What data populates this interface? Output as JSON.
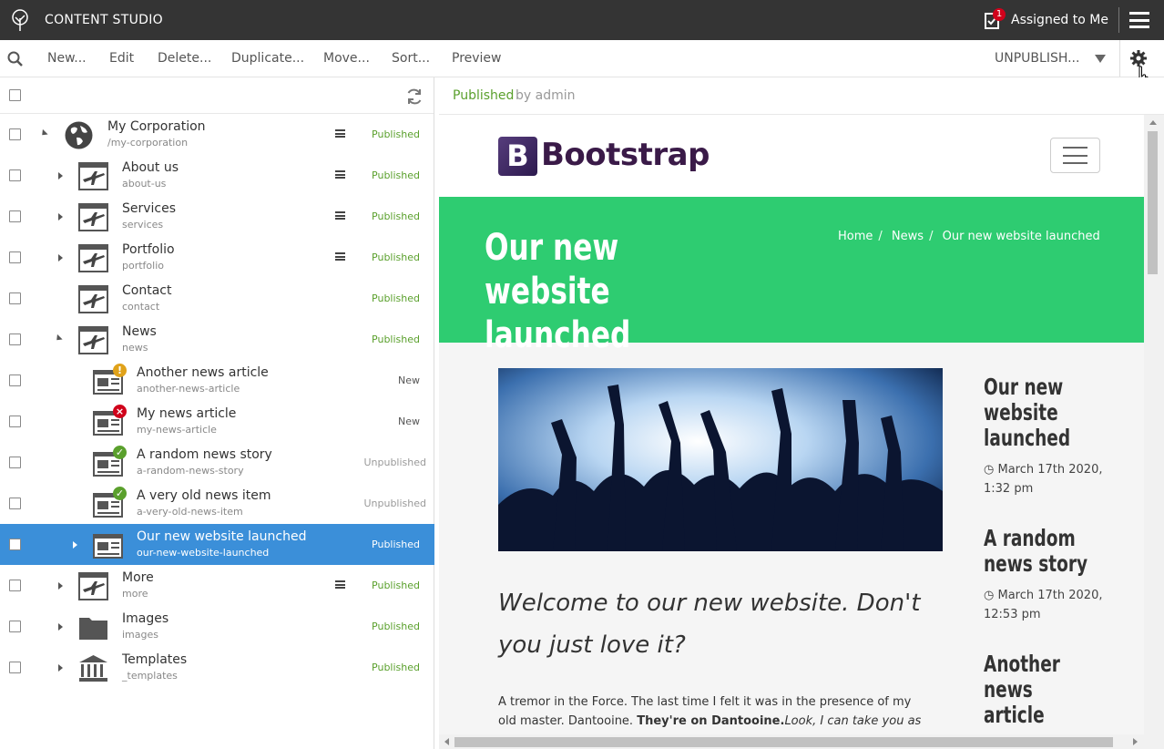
{
  "app": {
    "title": "CONTENT STUDIO"
  },
  "header": {
    "assigned_label": "Assigned to Me",
    "assigned_count": "1"
  },
  "toolbar": {
    "items": [
      "New...",
      "Edit",
      "Delete...",
      "Duplicate...",
      "Move...",
      "Sort...",
      "Preview"
    ],
    "unpublish_label": "UNPUBLISH..."
  },
  "tree": {
    "rows": [
      {
        "name": "My Corporation",
        "path": "/my-corporation",
        "status": "Published",
        "icon": "globe-icon",
        "has_menu": true,
        "toggle": "down",
        "level": 0
      },
      {
        "name": "About us",
        "path": "about-us",
        "status": "Published",
        "icon": "page-template-icon",
        "has_menu": true,
        "toggle": "right",
        "level": 1
      },
      {
        "name": "Services",
        "path": "services",
        "status": "Published",
        "icon": "page-template-icon",
        "has_menu": true,
        "toggle": "right",
        "level": 1
      },
      {
        "name": "Portfolio",
        "path": "portfolio",
        "status": "Published",
        "icon": "page-template-icon",
        "has_menu": true,
        "toggle": "right",
        "level": 1
      },
      {
        "name": "Contact",
        "path": "contact",
        "status": "Published",
        "icon": "page-template-icon",
        "has_menu": false,
        "toggle": "none",
        "level": 1
      },
      {
        "name": "News",
        "path": "news",
        "status": "Published",
        "icon": "page-template-icon",
        "has_menu": false,
        "toggle": "down",
        "level": 1
      },
      {
        "name": "Another news article",
        "path": "another-news-article",
        "status": "New",
        "icon": "article-icon",
        "badge": "warning",
        "level": 2
      },
      {
        "name": "My news article",
        "path": "my-news-article",
        "status": "New",
        "icon": "article-icon",
        "badge": "error",
        "level": 2
      },
      {
        "name": "A random news story",
        "path": "a-random-news-story",
        "status": "Unpublished",
        "icon": "article-icon",
        "badge": "ok",
        "level": 2
      },
      {
        "name": "A very old news item",
        "path": "a-very-old-news-item",
        "status": "Unpublished",
        "icon": "article-icon",
        "badge": "ok",
        "level": 2
      },
      {
        "name": "Our new website launched",
        "path": "our-new-website-launched",
        "status": "Published",
        "icon": "article-icon",
        "toggle": "right",
        "selected": true,
        "level": 2
      },
      {
        "name": "More",
        "path": "more",
        "status": "Published",
        "icon": "page-template-icon",
        "has_menu": true,
        "toggle": "right",
        "level": 1
      },
      {
        "name": "Images",
        "path": "images",
        "status": "Published",
        "icon": "folder-icon",
        "toggle": "right",
        "level": 1
      },
      {
        "name": "Templates",
        "path": "_templates",
        "status": "Published",
        "icon": "templates-icon",
        "toggle": "right",
        "level": 1
      }
    ]
  },
  "preview": {
    "status": "Published",
    "by": "by admin",
    "site": {
      "logo_letter": "B",
      "logo_text": "Bootstrap",
      "hero_title": "Our new website launched",
      "breadcrumb": [
        "Home",
        "News",
        "Our new website launched"
      ],
      "lead": "Welcome to our new website. Don't you just love it?",
      "body_plain": "A tremor in the Force. The last time I felt it was in the presence of my old master. Dantooine. ",
      "body_bold": "They're on Dantooine.",
      "body_italic": "Look, I can take you as far as",
      "sidebar": [
        {
          "title": "Our new website launched",
          "date": "March 17th 2020, 1:32 pm"
        },
        {
          "title": "A random news story",
          "date": "March 17th 2020, 12:53 pm"
        },
        {
          "title": "Another news article",
          "date": ""
        }
      ]
    }
  },
  "colors": {
    "topbar": "#343434",
    "selected": "#3b8fd9",
    "published": "#5aa02c",
    "hero": "#2ecc71"
  }
}
